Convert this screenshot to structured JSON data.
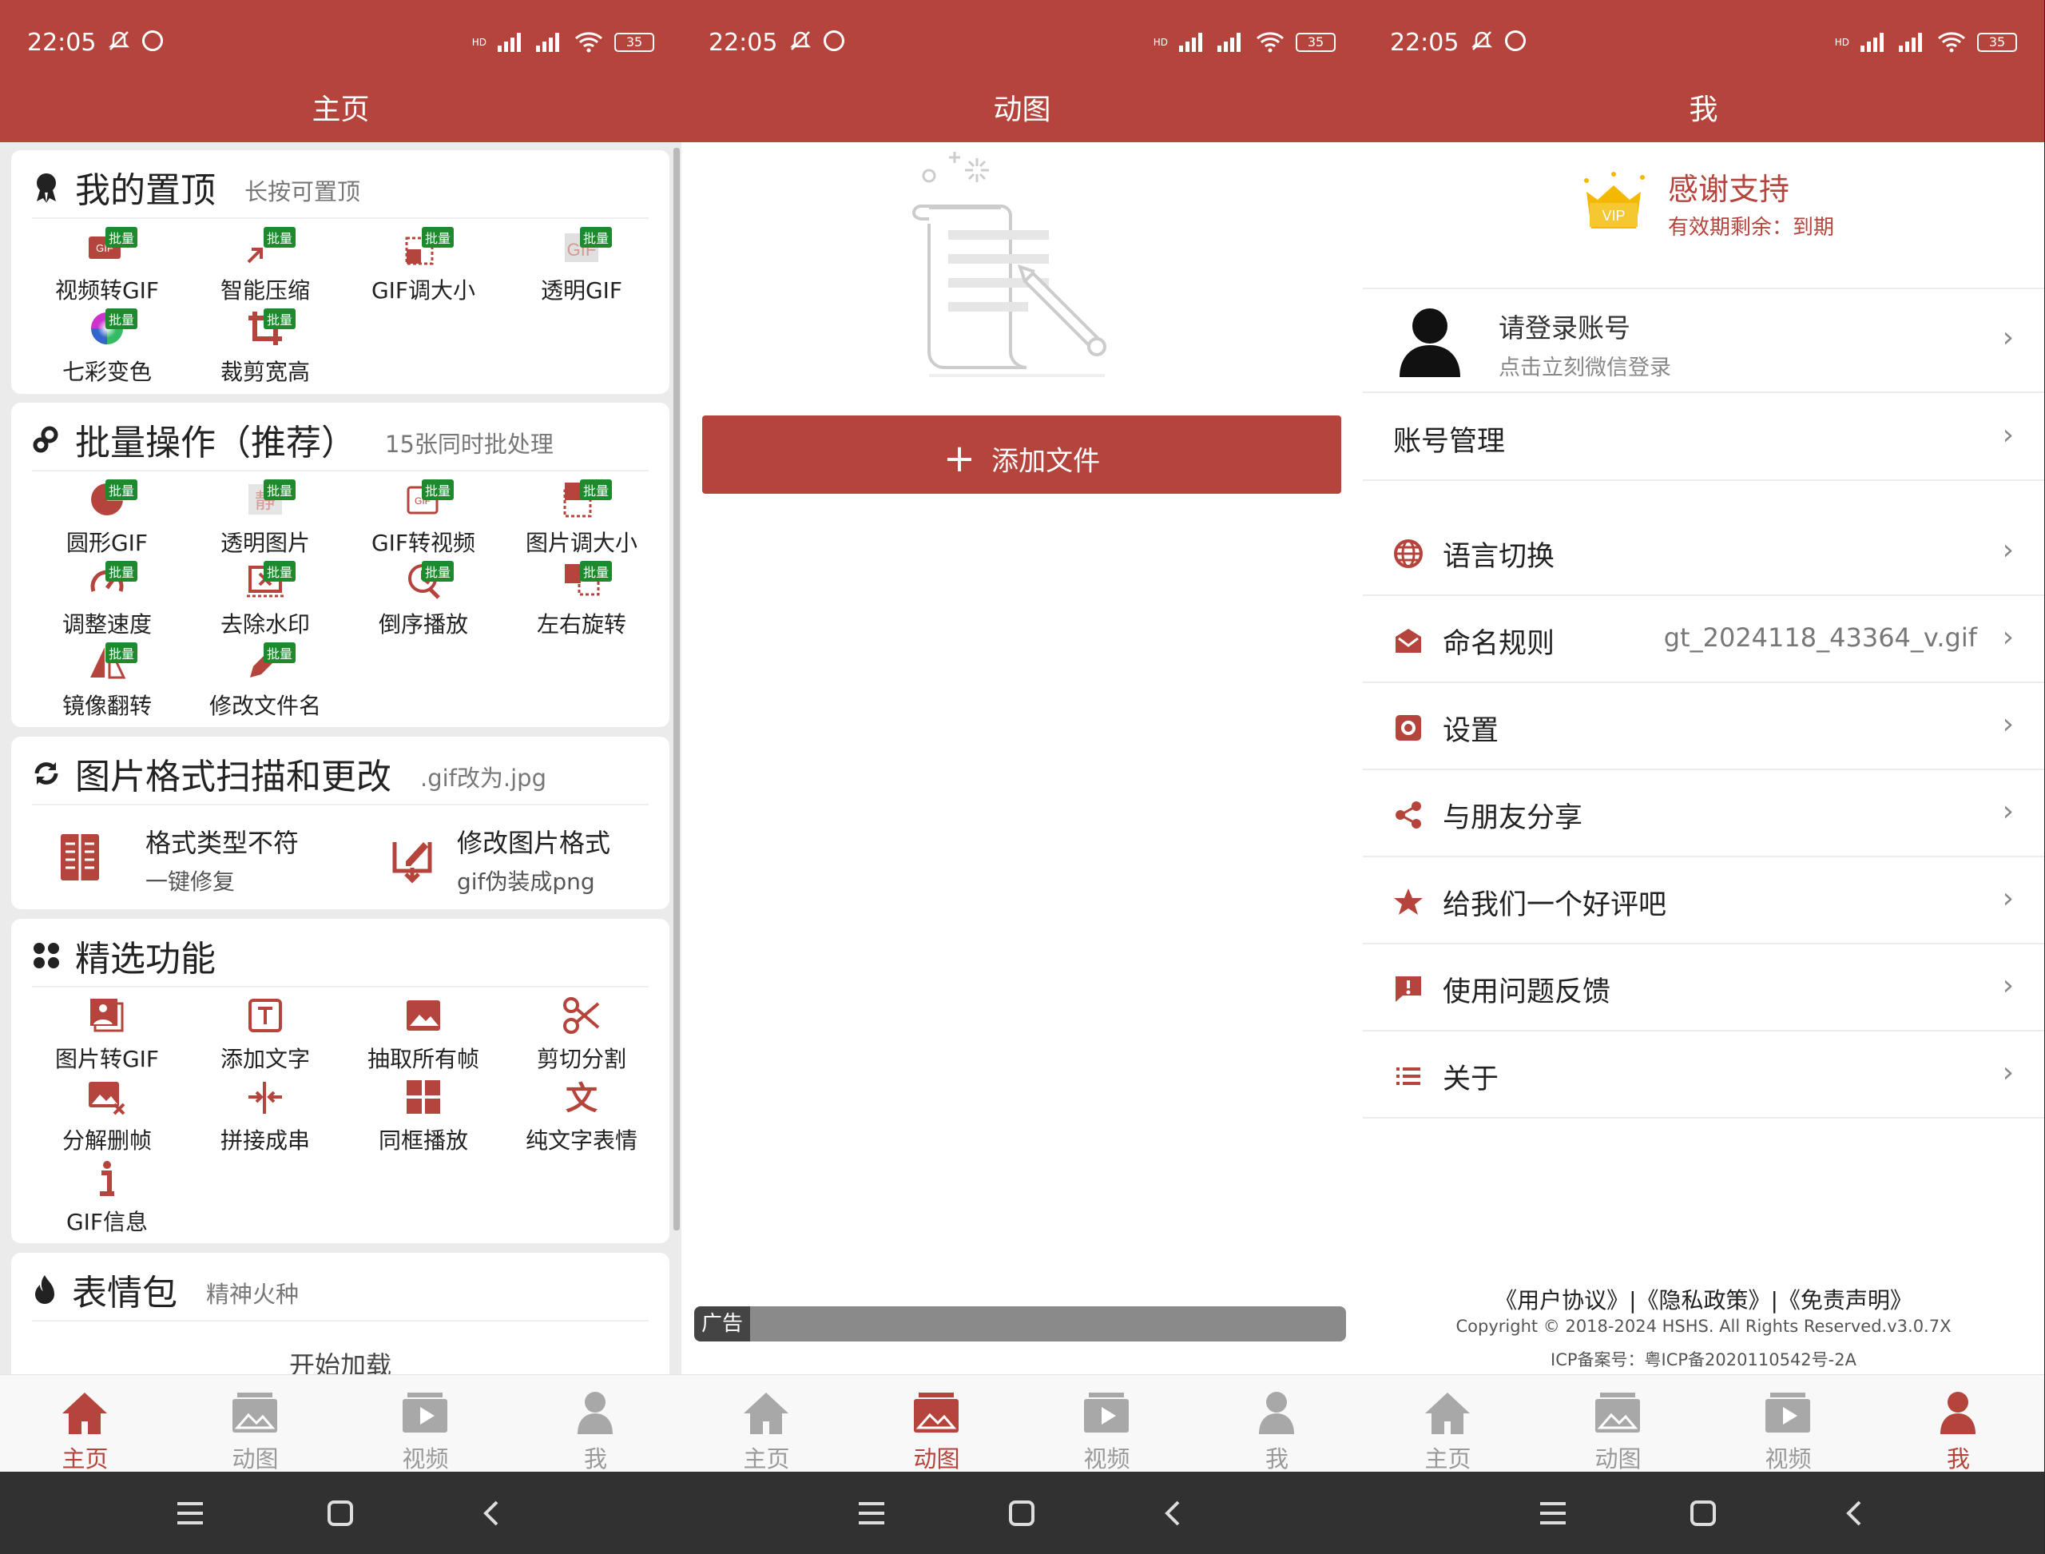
{
  "status": {
    "time": "22:05",
    "battery": "35",
    "hd": "HD"
  },
  "colors": {
    "brand": "#b5453c",
    "badge": "#1e8a2e",
    "inactive": "#9a9a9a"
  },
  "home": {
    "title": "主页",
    "badge": "批量",
    "pinned": {
      "title": "我的置顶",
      "subtitle": "长按可置顶",
      "items": [
        {
          "label": "视频转GIF",
          "icon": "video-to-gif-icon"
        },
        {
          "label": "智能压缩",
          "icon": "compress-icon"
        },
        {
          "label": "GIF调大小",
          "icon": "resize-gif-icon"
        },
        {
          "label": "透明GIF",
          "icon": "transparent-gif-icon"
        },
        {
          "label": "七彩变色",
          "icon": "color-wheel-icon"
        },
        {
          "label": "裁剪宽高",
          "icon": "crop-icon"
        }
      ]
    },
    "batch": {
      "title": "批量操作（推荐）",
      "subtitle": "15张同时批处理",
      "items": [
        {
          "label": "圆形GIF",
          "icon": "circle-gif-icon"
        },
        {
          "label": "透明图片",
          "icon": "transparent-image-icon",
          "glyph": "静"
        },
        {
          "label": "GIF转视频",
          "icon": "gif-to-video-icon"
        },
        {
          "label": "图片调大小",
          "icon": "image-resize-icon"
        },
        {
          "label": "调整速度",
          "icon": "speed-icon"
        },
        {
          "label": "去除水印",
          "icon": "remove-watermark-icon"
        },
        {
          "label": "倒序播放",
          "icon": "reverse-play-icon"
        },
        {
          "label": "左右旋转",
          "icon": "rotate-icon"
        },
        {
          "label": "镜像翻转",
          "icon": "mirror-icon"
        },
        {
          "label": "修改文件名",
          "icon": "rename-icon"
        }
      ]
    },
    "format": {
      "title": "图片格式扫描和更改",
      "subtitle": ".gif改为.jpg",
      "items": [
        {
          "title": "格式类型不符",
          "sub": "一键修复",
          "icon": "format-fix-icon"
        },
        {
          "title": "修改图片格式",
          "sub": "gif伪装成png",
          "icon": "format-change-icon"
        }
      ]
    },
    "featured": {
      "title": "精选功能",
      "items": [
        {
          "label": "图片转GIF",
          "icon": "image-to-gif-icon"
        },
        {
          "label": "添加文字",
          "icon": "add-text-icon"
        },
        {
          "label": "抽取所有帧",
          "icon": "extract-frames-icon"
        },
        {
          "label": "剪切分割",
          "icon": "scissors-icon"
        },
        {
          "label": "分解删帧",
          "icon": "delete-frames-icon"
        },
        {
          "label": "拼接成串",
          "icon": "join-icon"
        },
        {
          "label": "同框播放",
          "icon": "grid-play-icon"
        },
        {
          "label": "纯文字表情",
          "icon": "text-emoji-icon",
          "glyph": "文"
        },
        {
          "label": "GIF信息",
          "icon": "info-icon"
        }
      ]
    },
    "emoji": {
      "title": "表情包",
      "subtitle": "精神火种",
      "loading": "开始加载"
    }
  },
  "gifs": {
    "title": "动图",
    "add_button": "添加文件",
    "ad": "广告"
  },
  "me": {
    "title": "我",
    "vip": {
      "title": "感谢支持",
      "subtitle": "有效期剩余：到期",
      "badge": "VIP"
    },
    "login": {
      "title": "请登录账号",
      "subtitle": "点击立刻微信登录"
    },
    "account": "账号管理",
    "menu": [
      {
        "label": "语言切换",
        "icon": "globe-icon",
        "value": ""
      },
      {
        "label": "命名规则",
        "icon": "mail-icon",
        "value": "gt_2024118_43364_v.gif"
      },
      {
        "label": "设置",
        "icon": "settings-icon",
        "value": ""
      },
      {
        "label": "与朋友分享",
        "icon": "share-icon",
        "value": ""
      },
      {
        "label": "给我们一个好评吧",
        "icon": "star-icon",
        "value": ""
      },
      {
        "label": "使用问题反馈",
        "icon": "feedback-icon",
        "value": ""
      },
      {
        "label": "关于",
        "icon": "list-icon",
        "value": ""
      }
    ],
    "chevron": "›",
    "footer": {
      "links": "《用户协议》|《隐私政策》|《免责声明》",
      "copyright": "Copyright © 2018-2024 HSHS. All Rights Reserved.v3.0.7X",
      "icp": "ICP备案号：粤ICP备2020110542号-2A"
    }
  },
  "tabs": [
    {
      "label": "主页",
      "icon": "home-icon"
    },
    {
      "label": "动图",
      "icon": "gallery-icon"
    },
    {
      "label": "视频",
      "icon": "video-icon"
    },
    {
      "label": "我",
      "icon": "person-icon"
    }
  ]
}
